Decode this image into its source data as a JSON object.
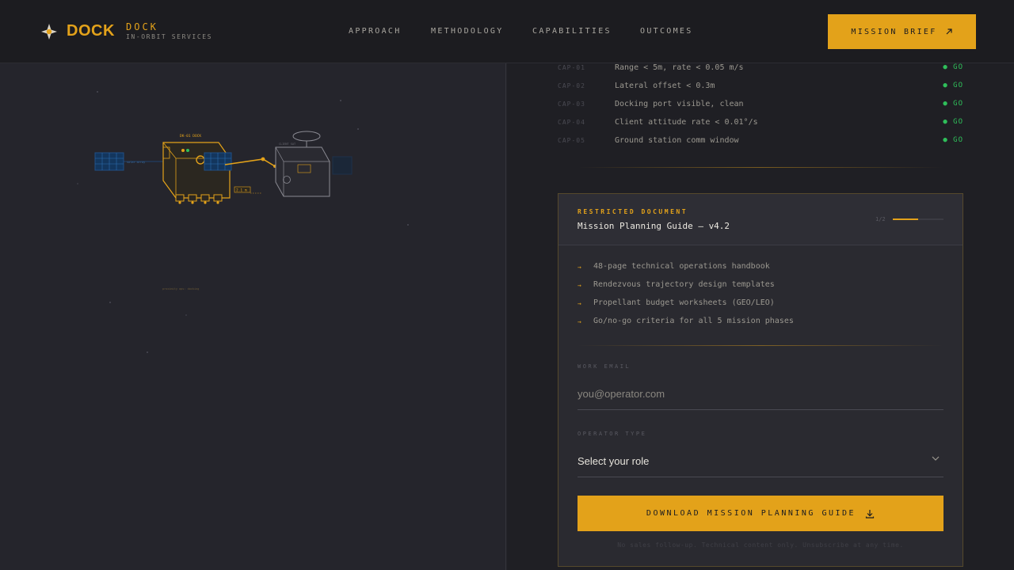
{
  "brand": {
    "name": "DOCK",
    "sub_title": "DOCK",
    "sub_tagline": "IN-ORBIT SERVICES",
    "accent_color": "#e3a21a"
  },
  "nav": {
    "items": [
      {
        "label": "APPROACH"
      },
      {
        "label": "METHODOLOGY"
      },
      {
        "label": "CAPABILITIES"
      },
      {
        "label": "OUTCOMES"
      }
    ],
    "cta_label": "MISSION BRIEF",
    "cta_icon": "arrow-up-right-icon"
  },
  "hero": {
    "diagram": {
      "servicer_label": "DK-01 DOCK",
      "client_label": "CLIENT SAT",
      "distance_readout": "2.1 m",
      "caption": "proximity ops: docking"
    }
  },
  "checklist": {
    "items": [
      {
        "id": "CAP-01",
        "text": "Range < 5m, rate < 0.05 m/s",
        "status": "● GO"
      },
      {
        "id": "CAP-02",
        "text": "Lateral offset < 0.3m",
        "status": "● GO"
      },
      {
        "id": "CAP-03",
        "text": "Docking port visible, clean",
        "status": "● GO"
      },
      {
        "id": "CAP-04",
        "text": "Client attitude rate < 0.01°/s",
        "status": "● GO"
      },
      {
        "id": "CAP-05",
        "text": "Ground station comm window",
        "status": "● GO"
      }
    ],
    "status_color": "#2fbf5a"
  },
  "document": {
    "kicker": "RESTRICTED DOCUMENT",
    "title": "Mission Planning Guide — v4.2",
    "step": "1/2",
    "progress": 0.5,
    "features": [
      "48-page technical operations handbook",
      "Rendezvous trajectory design templates",
      "Propellant budget worksheets (GEO/LEO)",
      "Go/no-go criteria for all 5 mission phases"
    ],
    "email_label": "WORK EMAIL",
    "email_placeholder": "you@operator.com",
    "email_value": "",
    "operator_label": "OPERATOR TYPE",
    "operator_value": "Select your role",
    "download_label": "DOWNLOAD MISSION PLANNING GUIDE",
    "download_icon": "download-icon",
    "fine_print": "No sales follow-up. Technical content only. Unsubscribe at any time."
  }
}
